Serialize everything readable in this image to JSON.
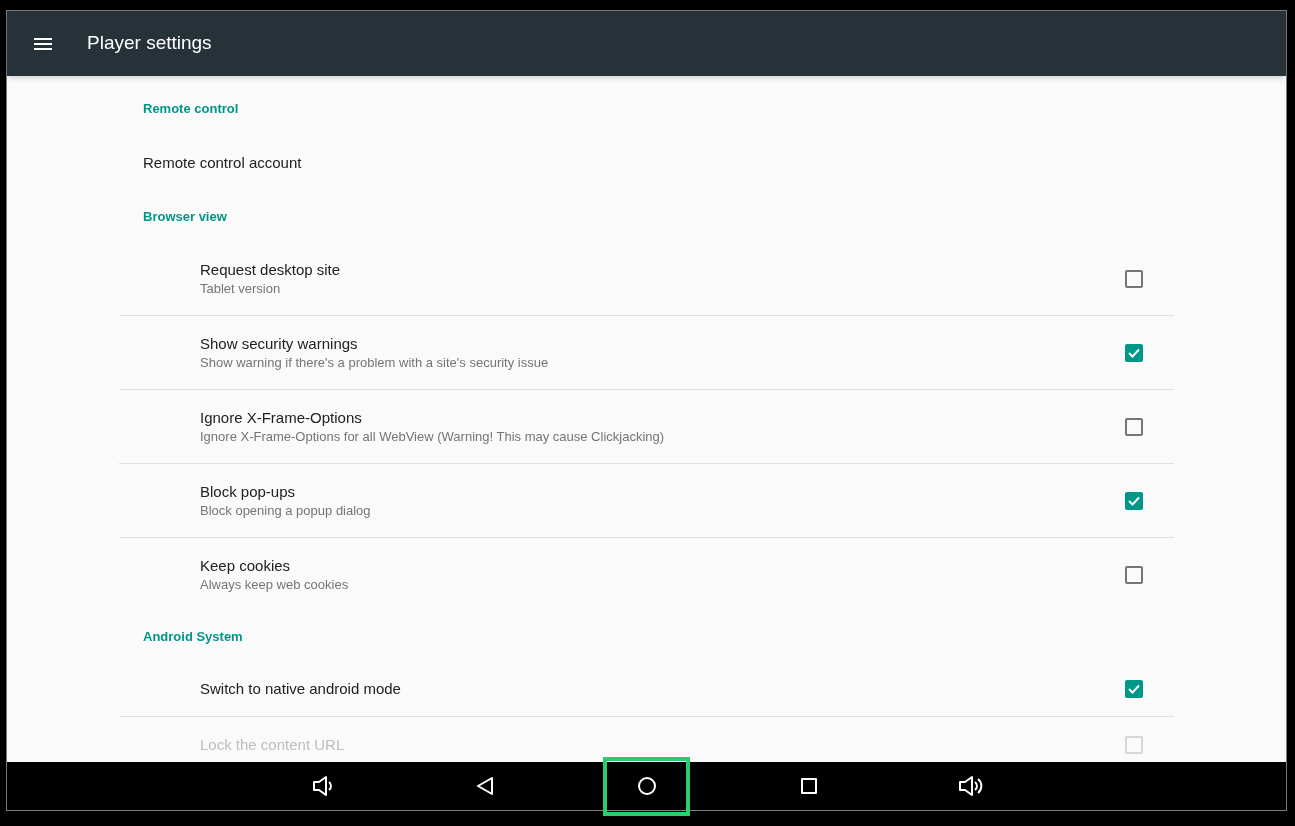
{
  "app_bar": {
    "title": "Player settings"
  },
  "sections": [
    {
      "header": "Remote control",
      "items": [
        {
          "kind": "link",
          "title": "Remote control account"
        }
      ]
    },
    {
      "header": "Browser view",
      "items": [
        {
          "kind": "checkbox",
          "title": "Request desktop site",
          "subtitle": "Tablet version",
          "checked": false,
          "disabled": false
        },
        {
          "kind": "checkbox",
          "title": "Show security warnings",
          "subtitle": "Show warning if there's a problem with a site's security issue",
          "checked": true,
          "disabled": false
        },
        {
          "kind": "checkbox",
          "title": "Ignore X-Frame-Options",
          "subtitle": "Ignore X-Frame-Options for all WebView (Warning! This may cause Clickjacking)",
          "checked": false,
          "disabled": false
        },
        {
          "kind": "checkbox",
          "title": "Block pop-ups",
          "subtitle": "Block opening a popup dialog",
          "checked": true,
          "disabled": false
        },
        {
          "kind": "checkbox",
          "title": "Keep cookies",
          "subtitle": "Always keep web cookies",
          "checked": false,
          "disabled": false
        }
      ]
    },
    {
      "header": "Android System",
      "items": [
        {
          "kind": "checkbox",
          "title": "Switch to native android mode",
          "checked": true,
          "disabled": false
        },
        {
          "kind": "checkbox",
          "title": "Lock the content URL",
          "checked": false,
          "disabled": true
        }
      ]
    }
  ],
  "nav_bar": [
    {
      "kind": "volume_down",
      "highlighted": false
    },
    {
      "kind": "back",
      "highlighted": false
    },
    {
      "kind": "home",
      "highlighted": true
    },
    {
      "kind": "recents",
      "highlighted": false
    },
    {
      "kind": "volume_up",
      "highlighted": false
    }
  ]
}
